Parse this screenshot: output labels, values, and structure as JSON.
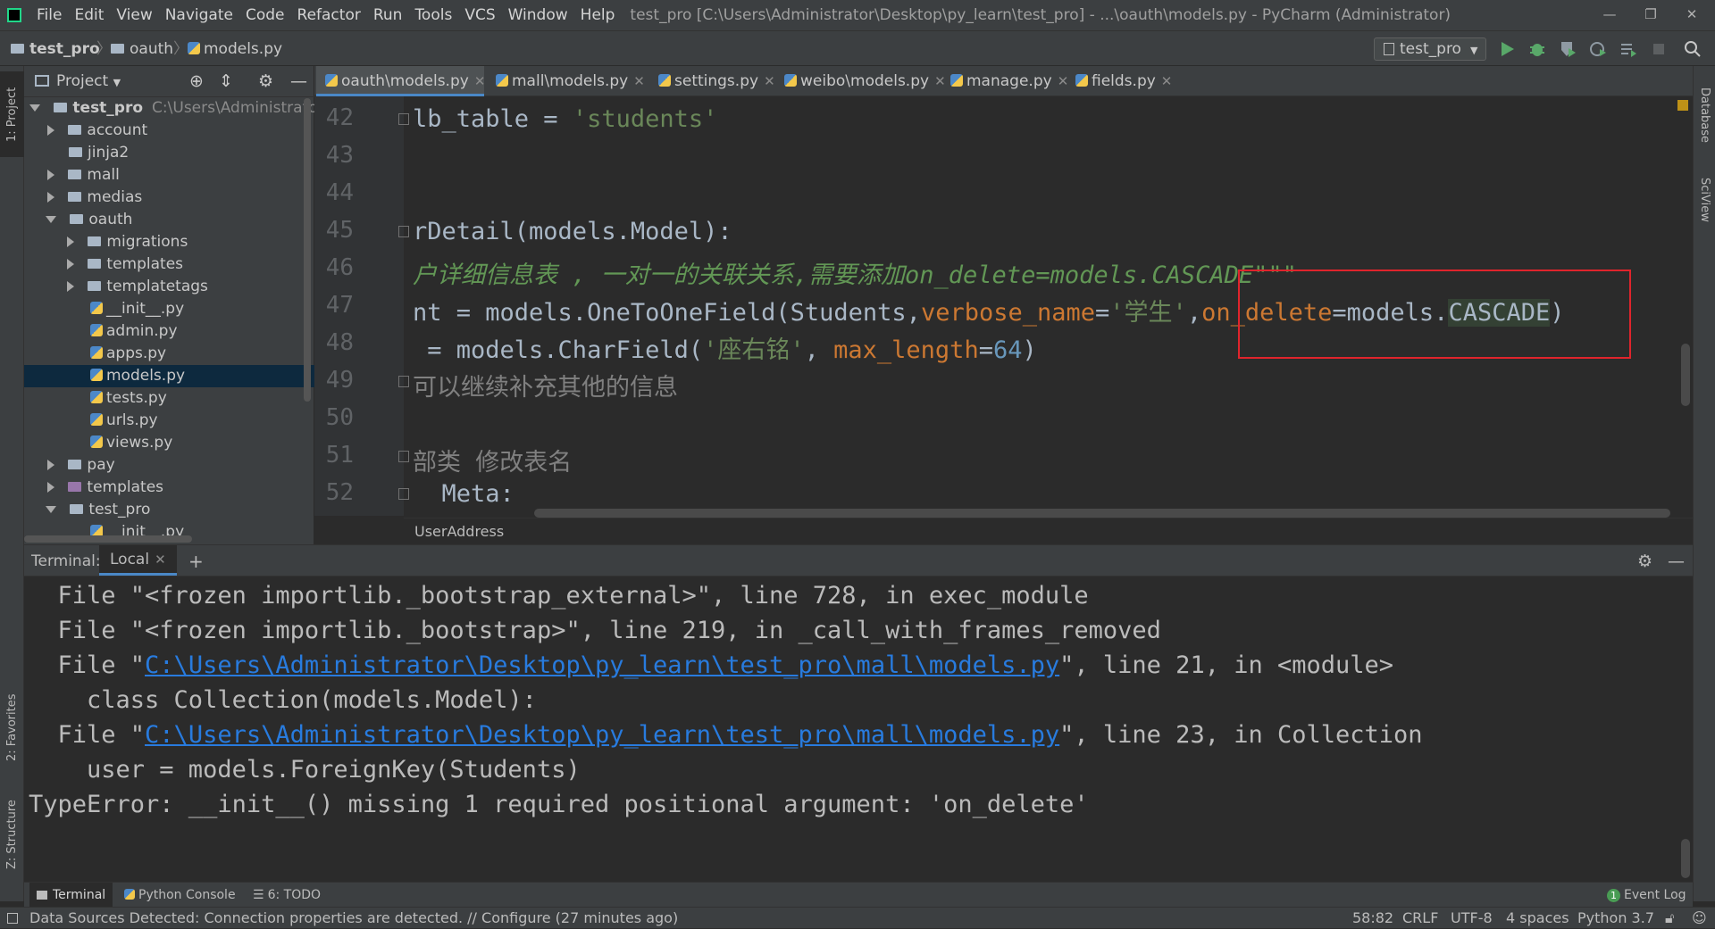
{
  "menubar": {
    "items": [
      "File",
      "Edit",
      "View",
      "Navigate",
      "Code",
      "Refactor",
      "Run",
      "Tools",
      "VCS",
      "Window",
      "Help"
    ],
    "title": "test_pro [C:\\Users\\Administrator\\Desktop\\py_learn\\test_pro] - ...\\oauth\\models.py - PyCharm (Administrator)"
  },
  "navbar": {
    "crumbs": [
      "test_pro",
      "oauth",
      "models.py"
    ],
    "run_config": "test_pro"
  },
  "left_stripe": {
    "project": "1: Project",
    "favorites": "2: Favorites",
    "structure": "Z: Structure"
  },
  "right_stripe": {
    "database": "Database",
    "sciview": "SciView"
  },
  "project": {
    "header": "Project",
    "root": "test_pro",
    "root_path": "C:\\Users\\Administrator\\Desktop\\py_learn\\test_pro",
    "items": [
      "account",
      "jinja2",
      "mall",
      "medias",
      "oauth",
      "migrations",
      "templates",
      "templatetags",
      "__init__.py",
      "admin.py",
      "apps.py",
      "models.py",
      "tests.py",
      "urls.py",
      "views.py",
      "pay",
      "templates",
      "test_pro",
      "__init__.py"
    ]
  },
  "tabs": [
    "oauth\\models.py",
    "mall\\models.py",
    "settings.py",
    "weibo\\models.py",
    "manage.py",
    "fields.py"
  ],
  "editor": {
    "line_numbers": [
      "42",
      "43",
      "44",
      "45",
      "46",
      "47",
      "48",
      "49",
      "50",
      "51",
      "52"
    ],
    "l42_a": "lb_table = ",
    "l42_b": "'students'",
    "l45": "rDetail(models.Model):",
    "l46": "户详细信息表 , 一对一的关联关系,需要添加on_delete=models.CASCADE\"\"\"",
    "l47_a": "nt = models.OneToOneField(Students,",
    "l47_b": "verbose_name",
    "l47_c": "=",
    "l47_d": "'学生'",
    "l47_e": ",",
    "l47_f": "on_delete",
    "l47_g": "=models.",
    "l47_h": "CASCADE",
    "l47_i": ")",
    "l48_a": " = models.CharField(",
    "l48_b": "'座右铭'",
    "l48_c": ", ",
    "l48_d": "max_length",
    "l48_e": "=",
    "l48_f": "64",
    "l48_g": ")",
    "l49": "可以继续补充其他的信息",
    "l51": "部类 修改表名",
    "l52": "  Meta:",
    "breadcrumb": "UserAddress"
  },
  "terminal": {
    "label": "Terminal:",
    "tab": "Local",
    "lines": {
      "l1": "  File \"<frozen importlib._bootstrap_external>\", line 728, in exec_module",
      "l2": "  File \"<frozen importlib._bootstrap>\", line 219, in _call_with_frames_removed",
      "l3_a": "  File \"",
      "l3_link": "C:\\Users\\Administrator\\Desktop\\py_learn\\test_pro\\mall\\models.py",
      "l3_b": "\", line 21, in <module>",
      "l4": "    class Collection(models.Model):",
      "l5_a": "  File \"",
      "l5_link": "C:\\Users\\Administrator\\Desktop\\py_learn\\test_pro\\mall\\models.py",
      "l5_b": "\", line 23, in Collection",
      "l6": "    user = models.ForeignKey(Students)",
      "l7": "TypeError: __init__() missing 1 required positional argument: 'on_delete'"
    }
  },
  "tool_strip": {
    "terminal": "Terminal",
    "python_console": "Python Console",
    "todo": "6: TODO",
    "event_log": "Event Log",
    "event_count": "1"
  },
  "status": {
    "message": "Data Sources Detected: Connection properties are detected. // Configure (27 minutes ago)",
    "position": "58:82",
    "line_sep": "CRLF",
    "encoding": "UTF-8",
    "indent": "4 spaces",
    "interpreter": "Python 3.7"
  },
  "colors": {
    "keyword": "#cc7832",
    "string": "#6a8759",
    "number": "#6897bb",
    "link": "#287bde",
    "highlight_box": "#e0242c"
  }
}
